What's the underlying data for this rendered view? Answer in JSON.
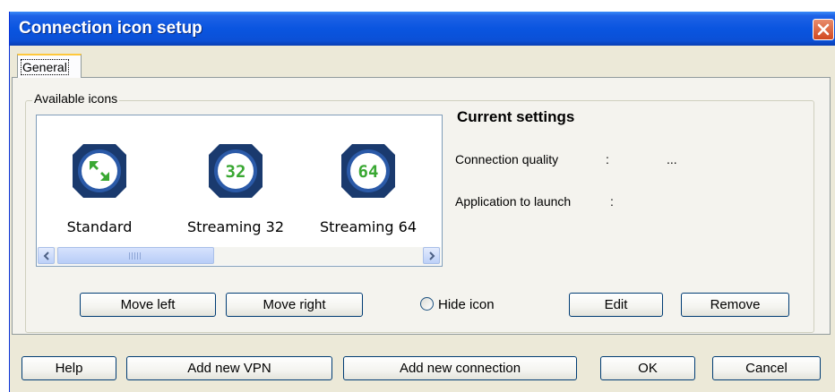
{
  "window": {
    "title": "Connection icon setup"
  },
  "tabs": [
    {
      "label": "General",
      "selected": true
    }
  ],
  "available_icons": {
    "group_label": "Available icons",
    "items": [
      {
        "label": "Standard",
        "icon": "standard-arrows-icon",
        "badge": ""
      },
      {
        "label": "Streaming 32",
        "icon": "streaming-32-icon",
        "badge": "32"
      },
      {
        "label": "Streaming 64",
        "icon": "streaming-64-icon",
        "badge": "64"
      }
    ],
    "scrollbar": {
      "left_arrow": "<",
      "right_arrow": ">"
    }
  },
  "current_settings": {
    "title": "Current settings",
    "rows": [
      {
        "label": "Connection quality",
        "separator": ":",
        "value": "..."
      },
      {
        "label": "Application to launch",
        "separator": ":",
        "value": ""
      }
    ]
  },
  "actions": {
    "move_left": "Move left",
    "move_right": "Move right",
    "hide_icon": "Hide icon",
    "edit": "Edit",
    "remove": "Remove"
  },
  "footer": {
    "help": "Help",
    "add_vpn": "Add new VPN",
    "add_connection": "Add new connection",
    "ok": "OK",
    "cancel": "Cancel"
  },
  "colors": {
    "titlebar": "#0a55e0",
    "dialog_bg": "#ece9d8",
    "icon_ring": "#1a3a6e",
    "icon_green": "#3aa833",
    "button_border": "#003c74"
  }
}
